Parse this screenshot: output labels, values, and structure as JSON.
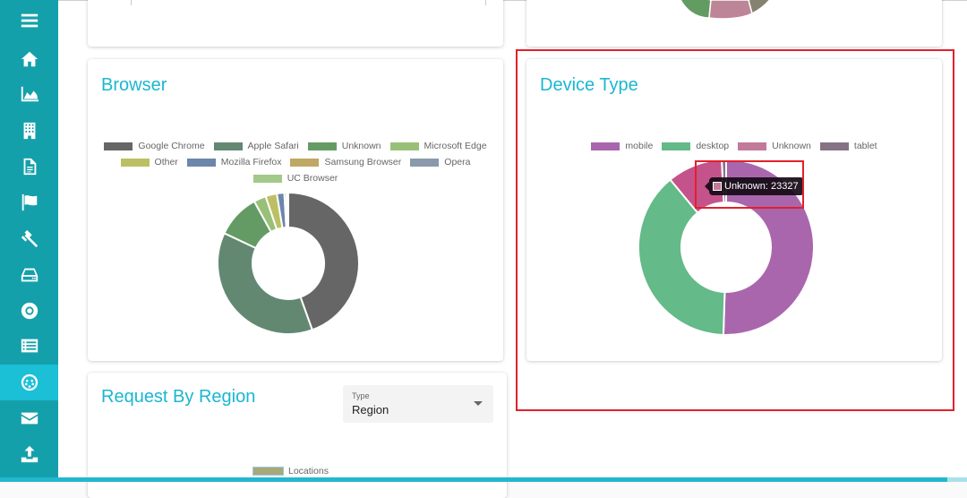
{
  "sidebar": {
    "items": [
      {
        "icon": "menu-icon"
      },
      {
        "icon": "home-icon"
      },
      {
        "icon": "area-chart-icon"
      },
      {
        "icon": "building-icon"
      },
      {
        "icon": "document-icon"
      },
      {
        "icon": "flag-icon"
      },
      {
        "icon": "gavel-icon"
      },
      {
        "icon": "hard-drive-icon"
      },
      {
        "icon": "life-ring-icon"
      },
      {
        "icon": "list-icon"
      },
      {
        "icon": "plug-connector-icon",
        "active": true
      },
      {
        "icon": "envelope-icon"
      },
      {
        "icon": "upload-icon"
      }
    ]
  },
  "browser_card": {
    "title": "Browser"
  },
  "device_card": {
    "title": "Device Type",
    "tooltip": {
      "label": "Unknown: 23327",
      "color": "#c27a9a"
    }
  },
  "region_card": {
    "title": "Request By Region",
    "select": {
      "label": "Type",
      "value": "Region"
    },
    "legend": [
      {
        "label": "Locations",
        "color": "#a8a878"
      }
    ]
  },
  "chart_data": [
    {
      "type": "pie",
      "title": "Browser",
      "legend_position": "top",
      "categories": [
        "Google Chrome",
        "Apple Safari",
        "Unknown",
        "Microsoft Edge",
        "Other",
        "Mozilla Firefox",
        "Samsung Browser",
        "Opera",
        "UC Browser"
      ],
      "values": [
        44.5,
        37.5,
        10.0,
        2.8,
        2.6,
        1.7,
        0.5,
        0.2,
        0.2
      ],
      "colors": [
        "#666666",
        "#638872",
        "#649b64",
        "#98c078",
        "#bdbf64",
        "#6d86ab",
        "#bfa865",
        "#8a9aac",
        "#a3c98a"
      ],
      "unit": "percent (estimated)"
    },
    {
      "type": "pie",
      "title": "Device Type",
      "legend_position": "top",
      "categories": [
        "mobile",
        "desktop",
        "Unknown",
        "tablet"
      ],
      "values": [
        50.5,
        38.5,
        10.2,
        0.8
      ],
      "colors": [
        "#a966ad",
        "#64ba88",
        "#c5538b",
        "#857385"
      ],
      "legend_colors": [
        "#a966ad",
        "#64ba88",
        "#c27a9a",
        "#857385"
      ],
      "annotations": [
        "Unknown: 23327"
      ],
      "unit": "percent (estimated)"
    }
  ]
}
